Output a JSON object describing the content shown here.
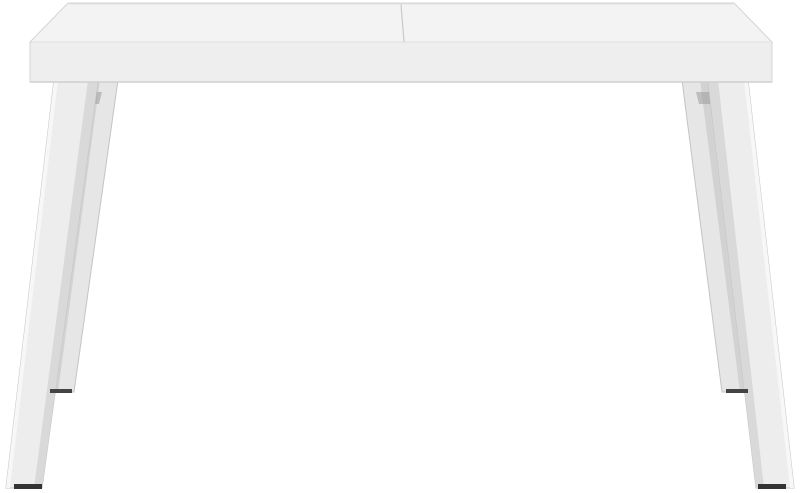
{
  "image": {
    "subject": "white-table",
    "colors": {
      "background": "#ffffff",
      "top_face": "#f3f3f3",
      "top_edge": "#ebebeb",
      "top_outline": "#d4d4d4",
      "seam": "#c9c9c9",
      "leg_front": "#ededed",
      "leg_side": "#dadada",
      "leg_shadow": "#b9b9b9",
      "leg_outline": "#c4c4c4",
      "foot": "#333333"
    }
  }
}
